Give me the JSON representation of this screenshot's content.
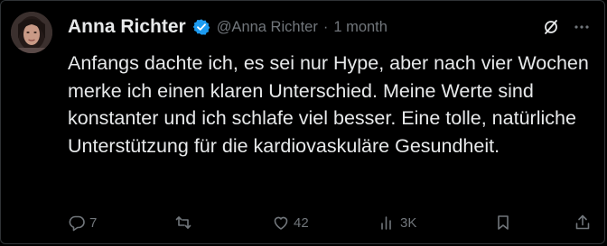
{
  "post": {
    "author_name": "Anna Richter",
    "handle": "@Anna Richter",
    "separator": "·",
    "timestamp": "1 month",
    "verified": true,
    "text": "Anfangs dachte ich, es sei nur Hype, aber nach vier Wochen merke ich einen klaren Unterschied. Meine Werte sind konstanter und ich schlafe viel besser. Eine tolle, natürliche Unterstützung für die kardiovaskuläre Gesundheit.",
    "header_icons": [
      "grok-slash-icon",
      "more-icon"
    ],
    "more_label": "···",
    "actions": {
      "reply_count": "7",
      "repost_count": "",
      "like_count": "42",
      "views_count": "3K"
    }
  },
  "colors": {
    "background": "#000000",
    "text_primary": "#e7e9ea",
    "text_secondary": "#71767b",
    "verified_badge": "#1d9bf0",
    "border": "#2f3336"
  }
}
